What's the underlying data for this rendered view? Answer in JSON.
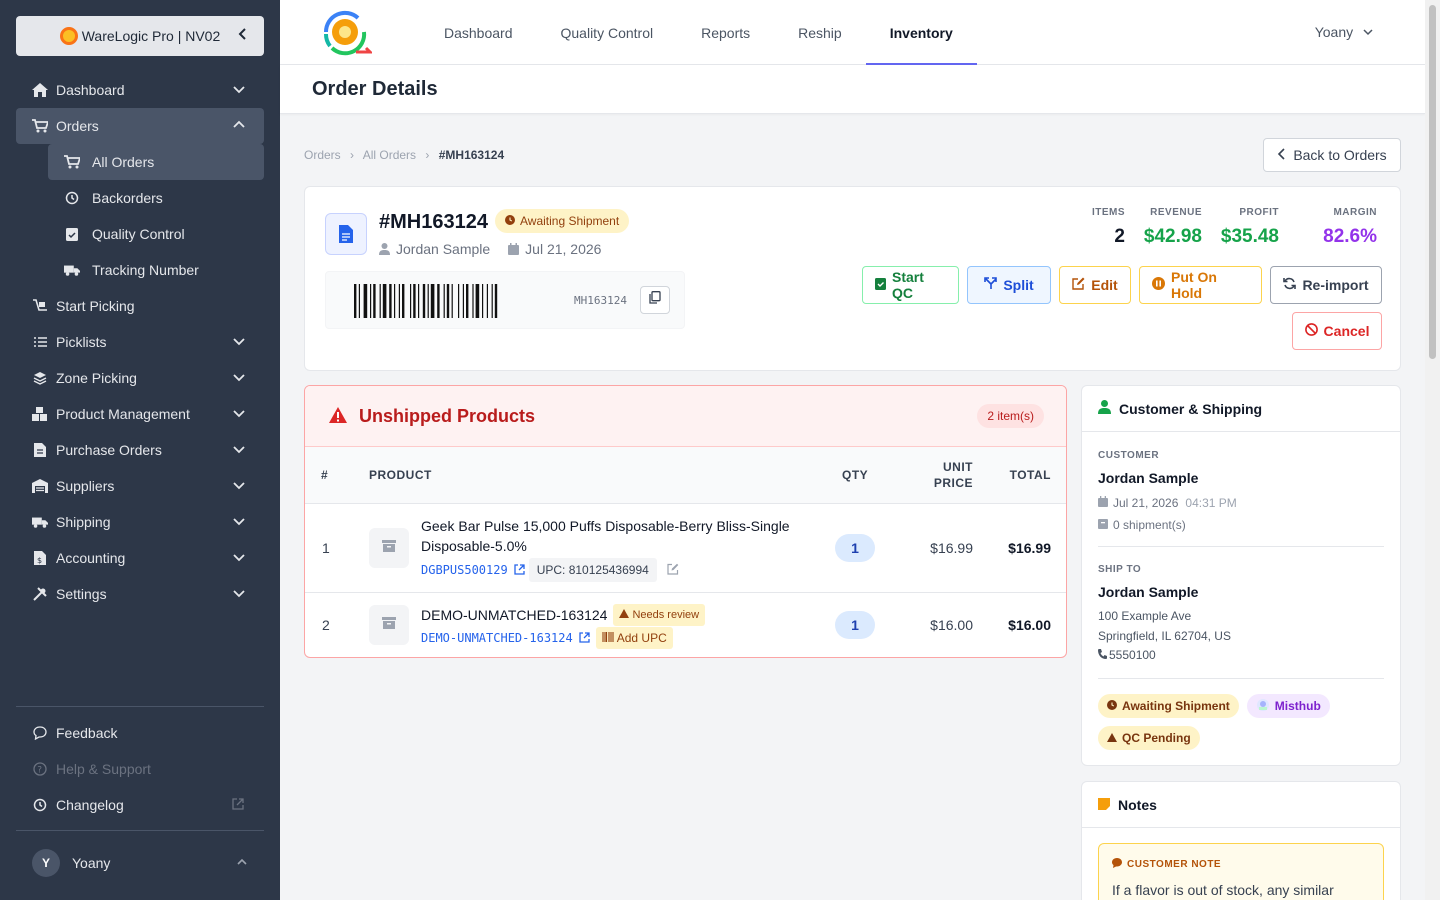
{
  "brand": {
    "name": "WareLogic Pro | NV02"
  },
  "sidebar": {
    "items": [
      {
        "label": "Dashboard"
      },
      {
        "label": "Orders"
      },
      {
        "label": "Start Picking"
      },
      {
        "label": "Picklists"
      },
      {
        "label": "Zone Picking"
      },
      {
        "label": "Product Management"
      },
      {
        "label": "Purchase Orders"
      },
      {
        "label": "Suppliers"
      },
      {
        "label": "Shipping"
      },
      {
        "label": "Accounting"
      },
      {
        "label": "Settings"
      }
    ],
    "orders_sub": [
      {
        "label": "All Orders"
      },
      {
        "label": "Backorders"
      },
      {
        "label": "Quality Control"
      },
      {
        "label": "Tracking Number"
      }
    ],
    "bottom": [
      {
        "label": "Feedback"
      },
      {
        "label": "Help & Support"
      },
      {
        "label": "Changelog"
      }
    ],
    "user": {
      "initial": "Y",
      "name": "Yoany"
    }
  },
  "topnav": {
    "tabs": [
      {
        "label": "Dashboard"
      },
      {
        "label": "Quality Control"
      },
      {
        "label": "Reports"
      },
      {
        "label": "Reship"
      },
      {
        "label": "Inventory"
      }
    ],
    "user": "Yoany"
  },
  "page": {
    "title": "Order Details"
  },
  "breadcrumb": {
    "items": [
      "Orders",
      "All Orders",
      "#MH163124"
    ]
  },
  "back_button": "Back to Orders",
  "order": {
    "id": "#MH163124",
    "status": "Awaiting Shipment",
    "customer": "Jordan Sample",
    "date": "Jul 21, 2026",
    "barcode_text": "MH163124",
    "stats": [
      {
        "label": "ITEMS",
        "value": "2",
        "color": "#111827"
      },
      {
        "label": "REVENUE",
        "value": "$42.98",
        "color": "#16a34a"
      },
      {
        "label": "PROFIT",
        "value": "$35.48",
        "color": "#16a34a"
      },
      {
        "label": "MARGIN",
        "value": "82.6%",
        "color": "#9333ea"
      }
    ],
    "actions": {
      "start_qc": "Start QC",
      "split": "Split",
      "edit": "Edit",
      "hold": "Put On Hold",
      "reimport": "Re-import",
      "cancel": "Cancel"
    }
  },
  "unshipped": {
    "title": "Unshipped Products",
    "count": "2 item(s)",
    "headers": {
      "num": "#",
      "product": "PRODUCT",
      "qty": "QTY",
      "unit_price_1": "UNIT",
      "unit_price_2": "PRICE",
      "total": "TOTAL"
    },
    "rows": [
      {
        "num": "1",
        "name_line1": "Geek Bar Pulse 15,000 Puffs Disposable-Berry Bliss-Single",
        "name_line2": "Disposable-5.0%",
        "sku": "DGBPUS500129",
        "upc": "UPC: 810125436994",
        "qty": "1",
        "unit_price": "$16.99",
        "total": "$16.99"
      },
      {
        "num": "2",
        "name": "DEMO-UNMATCHED-163124",
        "review": "Needs review",
        "sku": "DEMO-UNMATCHED-163124",
        "add_upc": "Add UPC",
        "qty": "1",
        "unit_price": "$16.00",
        "total": "$16.00"
      }
    ]
  },
  "customer_shipping": {
    "title": "Customer & Shipping",
    "customer_label": "CUSTOMER",
    "customer_name": "Jordan Sample",
    "order_date": "Jul 21, 2026",
    "order_time": "04:31 PM",
    "shipments": "0 shipment(s)",
    "ship_to_label": "SHIP TO",
    "ship_name": "Jordan Sample",
    "address1": "100 Example Ave",
    "address2": "Springfield, IL 62704, US",
    "phone": "5550100",
    "tags": {
      "status": "Awaiting Shipment",
      "source": "Misthub",
      "qc": "QC Pending"
    }
  },
  "notes": {
    "title": "Notes",
    "customer_note_label": "CUSTOMER NOTE",
    "customer_note_text": "If a flavor is out of stock, any similar"
  }
}
